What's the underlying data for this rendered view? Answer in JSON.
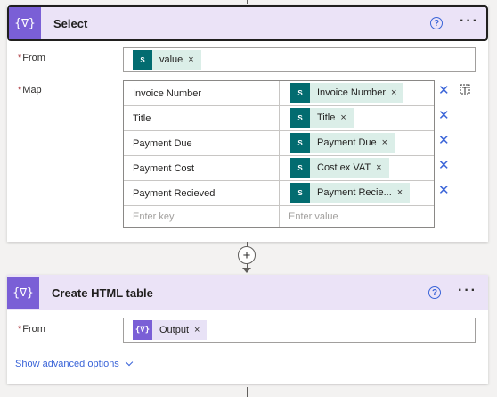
{
  "select_card": {
    "title": "Select",
    "icon": "data-operation-icon",
    "icon_glyph": "{∇}",
    "help_glyph": "?",
    "more_glyph": "···",
    "from": {
      "label": "From",
      "required_mark": "*",
      "token": {
        "label": "value",
        "icon": "sharepoint-icon",
        "icon_text": "S"
      }
    },
    "map": {
      "label": "Map",
      "required_mark": "*",
      "rows": [
        {
          "key": "Invoice Number",
          "value": "Invoice Number"
        },
        {
          "key": "Title",
          "value": "Title"
        },
        {
          "key": "Payment Due",
          "value": "Payment Due"
        },
        {
          "key": "Payment Cost",
          "value": "Cost ex VAT"
        },
        {
          "key": "Payment Recieved",
          "value": "Payment Recie..."
        }
      ],
      "key_placeholder": "Enter key",
      "value_placeholder": "Enter value"
    }
  },
  "html_card": {
    "title": "Create HTML table",
    "icon": "data-operation-icon",
    "icon_glyph": "{∇}",
    "help_glyph": "?",
    "more_glyph": "···",
    "from": {
      "label": "From",
      "required_mark": "*",
      "token": {
        "label": "Output",
        "icon": "data-operation-icon",
        "icon_text": "{∇}"
      }
    },
    "advanced_options": "Show advanced options"
  },
  "token_close": "×",
  "delete_glyph": "✕",
  "add_step_glyph": "+",
  "colors": {
    "header_bg": "#ebe3f7",
    "action_purple": "#7a5fd6",
    "sharepoint_teal": "#036c70",
    "token_bg": "#dbeee8",
    "link_blue": "#3a64d8"
  }
}
